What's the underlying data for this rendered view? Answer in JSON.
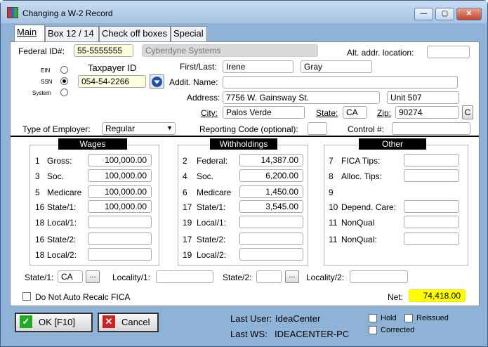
{
  "window": {
    "title": "Changing a W-2 Record",
    "min": "—",
    "max": "▢",
    "close": "✕"
  },
  "tabs": [
    "Main",
    "Box 12 / 14",
    "Check off boxes",
    "Special"
  ],
  "employer": {
    "fed_id_label": "Federal ID#:",
    "fed_id": "55-5555555",
    "company": "Cyberdyne Systems",
    "alt_addr_label": "Alt. addr. location:",
    "alt_addr": ""
  },
  "employee": {
    "ein_label": "EIN",
    "ssn_label": "SSN",
    "system_label": "System",
    "taxpayer_id_label": "Taxpayer ID",
    "taxpayer_id": "054-54-2266",
    "first_last_label": "First/Last:",
    "first": "Irene",
    "last": "Gray",
    "addit_name_label": "Addit. Name:",
    "addit_name": "",
    "address_label": "Address:",
    "address": "7756 W. Gainsway St.",
    "address2": "Unit 507",
    "city_label": "City:",
    "city": "Palos Verde",
    "state_label": "State:",
    "state": "CA",
    "zip_label": "Zip:",
    "zip": "90274",
    "c_button": "C"
  },
  "type_of_employer": {
    "label": "Type of Employer:",
    "value": "Regular",
    "reporting_label": "Reporting Code (optional):",
    "reporting": "",
    "control_label": "Control #:",
    "control": ""
  },
  "wages": {
    "header": "Wages",
    "rows": [
      {
        "num": "1",
        "label": "Gross:",
        "value": "100,000.00"
      },
      {
        "num": "3",
        "label": "Soc.",
        "value": "100,000.00"
      },
      {
        "num": "5",
        "label": "Medicare",
        "value": "100,000.00"
      },
      {
        "num": "16",
        "label": "State/1:",
        "value": "100,000.00"
      },
      {
        "num": "18",
        "label": "Local/1:",
        "value": ""
      },
      {
        "num": "16",
        "label": "State/2:",
        "value": ""
      },
      {
        "num": "18",
        "label": "Local/2:",
        "value": ""
      }
    ]
  },
  "withholdings": {
    "header": "Withholdings",
    "rows": [
      {
        "num": "2",
        "label": "Federal:",
        "value": "14,387.00"
      },
      {
        "num": "4",
        "label": "Soc.",
        "value": "6,200.00"
      },
      {
        "num": "6",
        "label": "Medicare",
        "value": "1,450.00"
      },
      {
        "num": "17",
        "label": "State/1:",
        "value": "3,545.00"
      },
      {
        "num": "19",
        "label": "Local/1:",
        "value": ""
      },
      {
        "num": "17",
        "label": "State/2:",
        "value": ""
      },
      {
        "num": "19",
        "label": "Local/2:",
        "value": ""
      }
    ]
  },
  "other": {
    "header": "Other",
    "rows": [
      {
        "num": "7",
        "label": "FICA Tips:",
        "value": ""
      },
      {
        "num": "8",
        "label": "Alloc. Tips:",
        "value": ""
      },
      {
        "num": "9",
        "label": "",
        "value": ""
      },
      {
        "num": "10",
        "label": "Depend. Care:",
        "value": ""
      },
      {
        "num": "11",
        "label": "NonQual",
        "value": ""
      },
      {
        "num": "11",
        "label": "NonQual:",
        "value": ""
      }
    ]
  },
  "bottom": {
    "state1_label": "State/1:",
    "state1": "CA",
    "locality1_label": "Locality/1:",
    "locality1": "",
    "state2_label": "State/2:",
    "state2": "",
    "locality2_label": "Locality/2:",
    "locality2": "",
    "browse": "...",
    "recalc_label": "Do Not Auto Recalc FICA",
    "net_label": "Net:",
    "net": "74,418.00"
  },
  "footer": {
    "ok": "OK [F10]",
    "cancel": "Cancel",
    "last_user_label": "Last User:",
    "last_user": "IdeaCenter",
    "last_ws_label": "Last WS:",
    "last_ws": "IDEACENTER-PC",
    "hold": "Hold",
    "reissued": "Reissued",
    "corrected": "Corrected"
  },
  "colors": {
    "net_bg": "#ffff00",
    "field_bg": "#ffffe0",
    "ok_icon": "#22aa22",
    "cancel_icon": "#cc2222"
  }
}
